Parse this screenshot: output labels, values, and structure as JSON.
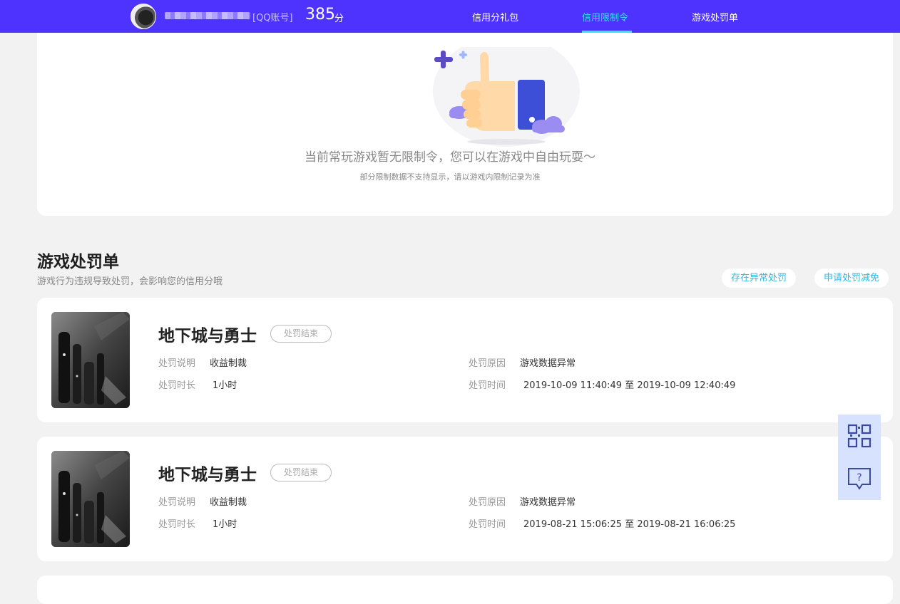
{
  "header": {
    "account_type": "[QQ账号]",
    "score": "385",
    "score_unit": "分",
    "nav": [
      {
        "label": "信用分礼包",
        "active": false
      },
      {
        "label": "信用限制令",
        "active": true
      },
      {
        "label": "游戏处罚单",
        "active": false
      }
    ],
    "accent_color": "#4e33ff",
    "active_color": "#3fe0ff"
  },
  "restrictions": {
    "message": "当前常玩游戏暂无限制令，您可以在游戏中自由玩耍～",
    "note": "部分限制数据不支持显示，请以游戏内限制记录为准"
  },
  "penalties": {
    "title": "游戏处罚单",
    "description": "游戏行为违规导致处罚，会影响您的信用分哦",
    "buttons": {
      "abnormal": "存在异常处罚",
      "appeal": "申请处罚减免"
    },
    "labels": {
      "explanation": "处罚说明",
      "duration": "处罚时长",
      "reason": "处罚原因",
      "time": "处罚时间"
    },
    "items": [
      {
        "game": "地下城与勇士",
        "status": "处罚结束",
        "explanation": "收益制裁",
        "duration": "1小时",
        "reason": "游戏数据异常",
        "time": "2019-10-09 11:40:49 至 2019-10-09 12:40:49"
      },
      {
        "game": "地下城与勇士",
        "status": "处罚结束",
        "explanation": "收益制裁",
        "duration": "1小时",
        "reason": "游戏数据异常",
        "time": "2019-08-21 15:06:25 至 2019-08-21 16:06:25"
      }
    ]
  },
  "side_tools": {
    "icons": [
      "qr-code-icon",
      "feedback-question-icon"
    ]
  }
}
